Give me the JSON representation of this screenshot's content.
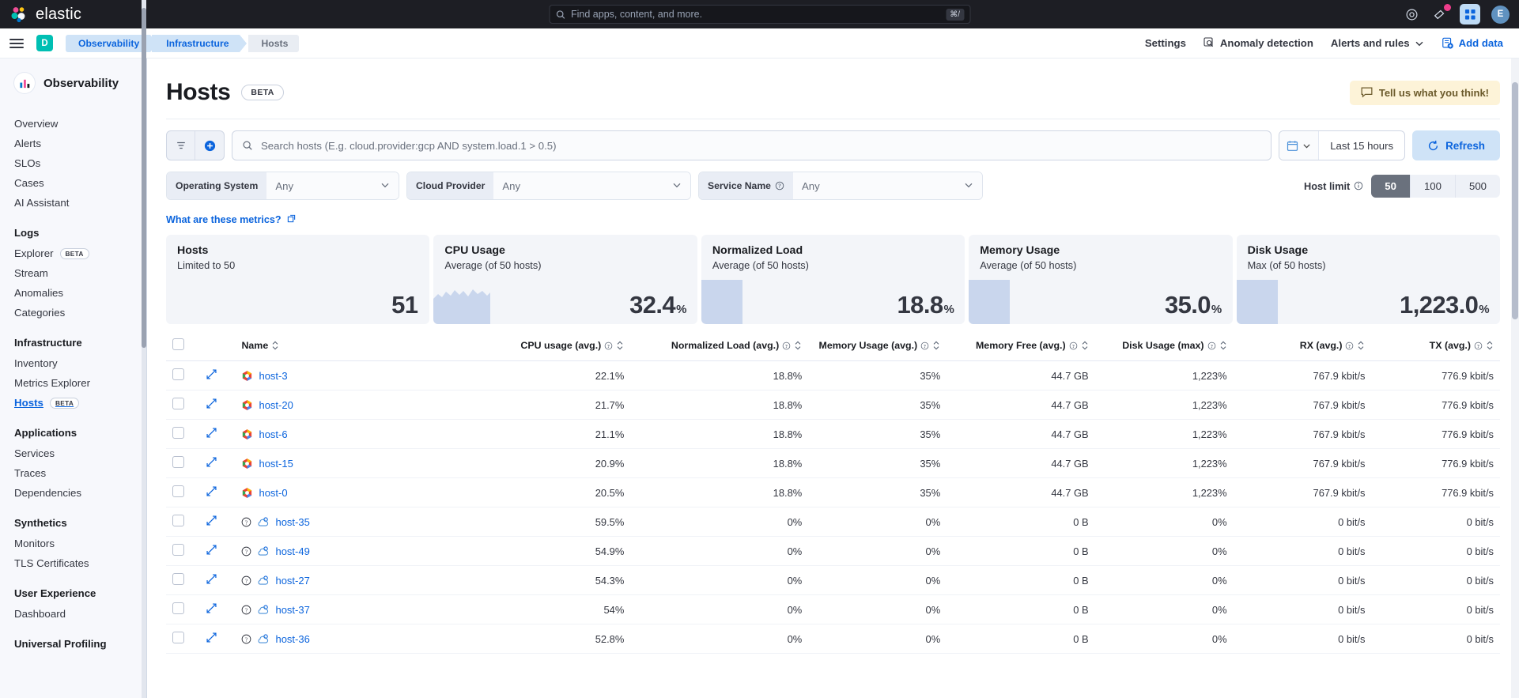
{
  "topbar": {
    "brand": "elastic",
    "search_placeholder": "Find apps, content, and more.",
    "search_kbd": "⌘/",
    "icons": [
      "help-icon",
      "announcements-icon",
      "apps-grid-icon"
    ],
    "avatar_initial": "E"
  },
  "breadcrumb": {
    "space_initial": "D",
    "items": [
      "Observability",
      "Infrastructure",
      "Hosts"
    ]
  },
  "toolbar_right": {
    "settings": "Settings",
    "anomaly_detection": "Anomaly detection",
    "alerts_and_rules": "Alerts and rules",
    "add_data": "Add data"
  },
  "sidebar": {
    "title": "Observability",
    "items": [
      {
        "label": "Overview",
        "active": false
      },
      {
        "label": "Alerts",
        "active": false
      },
      {
        "label": "SLOs",
        "active": false
      },
      {
        "label": "Cases",
        "active": false
      },
      {
        "label": "AI Assistant",
        "active": false
      }
    ],
    "groups": [
      {
        "title": "Logs",
        "items": [
          {
            "label": "Explorer",
            "badge": "BETA",
            "active": false
          },
          {
            "label": "Stream",
            "active": false
          },
          {
            "label": "Anomalies",
            "active": false
          },
          {
            "label": "Categories",
            "active": false
          }
        ]
      },
      {
        "title": "Infrastructure",
        "items": [
          {
            "label": "Inventory",
            "active": false
          },
          {
            "label": "Metrics Explorer",
            "active": false
          },
          {
            "label": "Hosts",
            "badge": "BETA",
            "active": true
          }
        ]
      },
      {
        "title": "Applications",
        "items": [
          {
            "label": "Services",
            "active": false
          },
          {
            "label": "Traces",
            "active": false
          },
          {
            "label": "Dependencies",
            "active": false
          }
        ]
      },
      {
        "title": "Synthetics",
        "items": [
          {
            "label": "Monitors",
            "active": false
          },
          {
            "label": "TLS Certificates",
            "active": false
          }
        ]
      },
      {
        "title": "User Experience",
        "items": [
          {
            "label": "Dashboard",
            "active": false
          }
        ]
      },
      {
        "title": "Universal Profiling",
        "items": []
      }
    ]
  },
  "page": {
    "title": "Hosts",
    "beta_badge": "BETA",
    "feedback_button": "Tell us what you think!"
  },
  "search": {
    "placeholder": "Search hosts (E.g. cloud.provider:gcp AND system.load.1 > 0.5)"
  },
  "datepicker": {
    "value": "Last 15 hours",
    "refresh_label": "Refresh"
  },
  "filters": [
    {
      "label": "Operating System",
      "value": "Any",
      "info": false
    },
    {
      "label": "Cloud Provider",
      "value": "Any",
      "info": false
    },
    {
      "label": "Service Name",
      "value": "Any",
      "info": true
    }
  ],
  "host_limit": {
    "label": "Host limit",
    "options": [
      "50",
      "100",
      "500"
    ],
    "selected": "50"
  },
  "metrics_link": "What are these metrics?",
  "kpis": [
    {
      "title": "Hosts",
      "subtitle": "Limited to 50",
      "value": "51",
      "unit": "",
      "spark": "none"
    },
    {
      "title": "CPU Usage",
      "subtitle": "Average (of 50 hosts)",
      "value": "32.4",
      "unit": "%",
      "spark": "area"
    },
    {
      "title": "Normalized Load",
      "subtitle": "Average (of 50 hosts)",
      "value": "18.8",
      "unit": "%",
      "spark": "block"
    },
    {
      "title": "Memory Usage",
      "subtitle": "Average (of 50 hosts)",
      "value": "35.0",
      "unit": "%",
      "spark": "block"
    },
    {
      "title": "Disk Usage",
      "subtitle": "Max (of 50 hosts)",
      "value": "1,223.0",
      "unit": "%",
      "spark": "block"
    }
  ],
  "table": {
    "columns": [
      {
        "label": "Name",
        "align": "left",
        "info": false,
        "sortable": true
      },
      {
        "label": "CPU usage (avg.)",
        "align": "right",
        "info": true,
        "sortable": true
      },
      {
        "label": "Normalized Load (avg.)",
        "align": "right",
        "info": true,
        "sortable": true
      },
      {
        "label": "Memory Usage (avg.)",
        "align": "right",
        "info": true,
        "sortable": true
      },
      {
        "label": "Memory Free (avg.)",
        "align": "right",
        "info": true,
        "sortable": true
      },
      {
        "label": "Disk Usage (max)",
        "align": "right",
        "info": true,
        "sortable": true
      },
      {
        "label": "RX (avg.)",
        "align": "right",
        "info": true,
        "sortable": true
      },
      {
        "label": "TX (avg.)",
        "align": "right",
        "info": true,
        "sortable": true
      }
    ],
    "rows": [
      {
        "name": "host-3",
        "icon": "gcp-icon",
        "cpu": "22.1%",
        "load": "18.8%",
        "mem": "35%",
        "memfree": "44.7 GB",
        "disk": "1,223%",
        "rx": "767.9 kbit/s",
        "tx": "776.9 kbit/s"
      },
      {
        "name": "host-20",
        "icon": "gcp-icon",
        "cpu": "21.7%",
        "load": "18.8%",
        "mem": "35%",
        "memfree": "44.7 GB",
        "disk": "1,223%",
        "rx": "767.9 kbit/s",
        "tx": "776.9 kbit/s"
      },
      {
        "name": "host-6",
        "icon": "gcp-icon",
        "cpu": "21.1%",
        "load": "18.8%",
        "mem": "35%",
        "memfree": "44.7 GB",
        "disk": "1,223%",
        "rx": "767.9 kbit/s",
        "tx": "776.9 kbit/s"
      },
      {
        "name": "host-15",
        "icon": "gcp-icon",
        "cpu": "20.9%",
        "load": "18.8%",
        "mem": "35%",
        "memfree": "44.7 GB",
        "disk": "1,223%",
        "rx": "767.9 kbit/s",
        "tx": "776.9 kbit/s"
      },
      {
        "name": "host-0",
        "icon": "gcp-icon",
        "cpu": "20.5%",
        "load": "18.8%",
        "mem": "35%",
        "memfree": "44.7 GB",
        "disk": "1,223%",
        "rx": "767.9 kbit/s",
        "tx": "776.9 kbit/s"
      },
      {
        "name": "host-35",
        "icon": "cloud-icon",
        "cpu": "59.5%",
        "load": "0%",
        "mem": "0%",
        "memfree": "0 B",
        "disk": "0%",
        "rx": "0 bit/s",
        "tx": "0 bit/s"
      },
      {
        "name": "host-49",
        "icon": "cloud-icon",
        "cpu": "54.9%",
        "load": "0%",
        "mem": "0%",
        "memfree": "0 B",
        "disk": "0%",
        "rx": "0 bit/s",
        "tx": "0 bit/s"
      },
      {
        "name": "host-27",
        "icon": "cloud-icon",
        "cpu": "54.3%",
        "load": "0%",
        "mem": "0%",
        "memfree": "0 B",
        "disk": "0%",
        "rx": "0 bit/s",
        "tx": "0 bit/s"
      },
      {
        "name": "host-37",
        "icon": "cloud-icon",
        "cpu": "54%",
        "load": "0%",
        "mem": "0%",
        "memfree": "0 B",
        "disk": "0%",
        "rx": "0 bit/s",
        "tx": "0 bit/s"
      },
      {
        "name": "host-36",
        "icon": "cloud-icon",
        "cpu": "52.8%",
        "load": "0%",
        "mem": "0%",
        "memfree": "0 B",
        "disk": "0%",
        "rx": "0 bit/s",
        "tx": "0 bit/s"
      }
    ]
  },
  "colors": {
    "accent_blue": "#0b64dd",
    "dark_header": "#1d1e24",
    "teal": "#00bfb3",
    "pink": "#ee3d8b",
    "kpi_bg": "#f3f5f9",
    "spark_fill": "#c9d6ed"
  }
}
